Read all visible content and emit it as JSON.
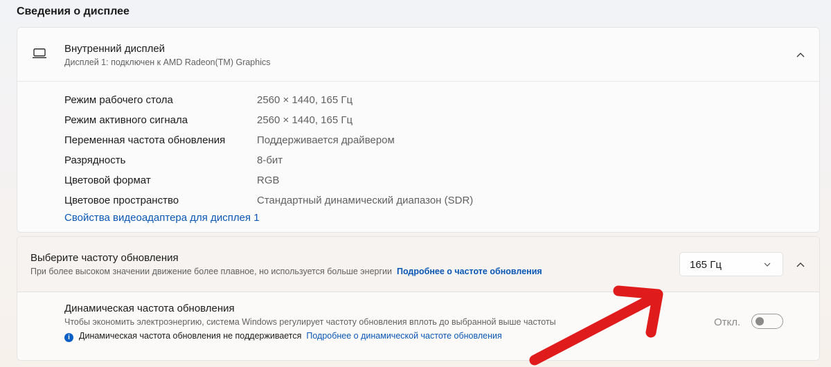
{
  "section_title": "Сведения о дисплее",
  "display": {
    "name": "Внутренний дисплей",
    "subtitle": "Дисплей 1: подключен к AMD Radeon(TM) Graphics",
    "rows": [
      {
        "k": "Режим рабочего стола",
        "v": "2560 × 1440, 165 Гц"
      },
      {
        "k": "Режим активного сигнала",
        "v": "2560 × 1440, 165 Гц"
      },
      {
        "k": "Переменная частота обновления",
        "v": "Поддерживается драйвером"
      },
      {
        "k": "Разрядность",
        "v": "8-бит"
      },
      {
        "k": "Цветовой формат",
        "v": "RGB"
      },
      {
        "k": "Цветовое пространство",
        "v": "Стандартный динамический диапазон (SDR)"
      }
    ],
    "adapter_link": "Свойства видеоадаптера для дисплея 1"
  },
  "refresh": {
    "title": "Выберите частоту обновления",
    "desc": "При более высоком значении движение более плавное, но используется больше энергии",
    "link": "Подробнее о частоте обновления",
    "selected": "165 Гц"
  },
  "dynamic": {
    "title": "Динамическая частота обновления",
    "desc": "Чтобы экономить электроэнергию, система Windows регулирует частоту обновления вплоть до выбранной выше частоты",
    "info_icon": "i",
    "note": "Динамическая частота обновления не поддерживается",
    "link": "Подробнее о динамической частоте обновления",
    "state": "Откл."
  },
  "annotation_color": "#e01b1b"
}
